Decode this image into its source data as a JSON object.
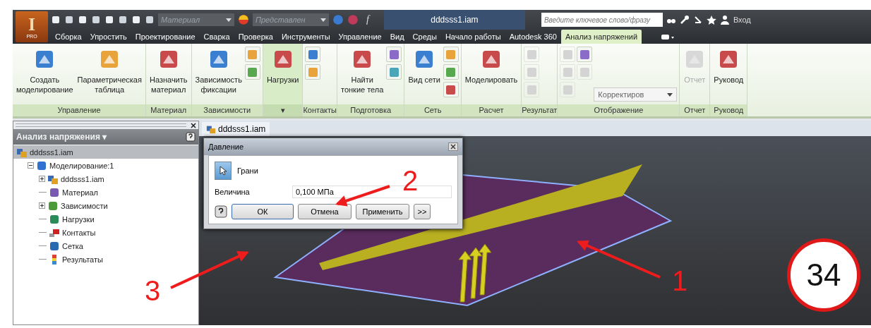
{
  "title_bar": {
    "app_letter": "I",
    "app_edition": "PRO",
    "material_combo": "Материал",
    "appearance_combo": "Представлен",
    "formula_label": "f",
    "document_title": "dddsss1.iam",
    "search": {
      "placeholder": "Введите ключевое слово/фразу"
    },
    "sign_in": "Вход"
  },
  "tabs": [
    {
      "label": "Сборка",
      "selected": false
    },
    {
      "label": "Упростить",
      "selected": false
    },
    {
      "label": "Проектирование",
      "selected": false
    },
    {
      "label": "Сварка",
      "selected": false
    },
    {
      "label": "Проверка",
      "selected": false
    },
    {
      "label": "Инструменты",
      "selected": false
    },
    {
      "label": "Управление",
      "selected": false
    },
    {
      "label": "Вид",
      "selected": false
    },
    {
      "label": "Среды",
      "selected": false
    },
    {
      "label": "Начало работы",
      "selected": false
    },
    {
      "label": "Autodesk 360",
      "selected": false
    },
    {
      "label": "Анализ напряжений",
      "selected": true
    }
  ],
  "ribbon_panels": [
    {
      "label": "Управление",
      "highlighted": false,
      "items": [
        {
          "kind": "large",
          "label": "Создать\nмоделирование",
          "disabled": false
        },
        {
          "kind": "large",
          "label": "Параметрическая\nтаблица",
          "disabled": false
        }
      ]
    },
    {
      "label": "Материал",
      "highlighted": false,
      "items": [
        {
          "kind": "large",
          "label": "Назначить\nматериал",
          "disabled": false
        }
      ]
    },
    {
      "label": "Зависимости",
      "highlighted": false,
      "items": [
        {
          "kind": "large",
          "label": "Зависимость\nфиксации",
          "disabled": false
        },
        {
          "kind": "stack",
          "buttons": [
            {
              "disabled": false
            },
            {
              "disabled": false
            }
          ]
        }
      ]
    },
    {
      "label": "▾",
      "highlighted": true,
      "items": [
        {
          "kind": "large",
          "label": "Нагрузки",
          "disabled": false
        }
      ]
    },
    {
      "label": "Контакты",
      "highlighted": false,
      "items": [
        {
          "kind": "stack",
          "buttons": [
            {
              "disabled": false
            },
            {
              "disabled": false
            }
          ]
        }
      ]
    },
    {
      "label": "Подготовка",
      "highlighted": false,
      "items": [
        {
          "kind": "large",
          "label": "Найти\nтонкие тела",
          "disabled": false
        },
        {
          "kind": "stack",
          "buttons": [
            {
              "disabled": false
            },
            {
              "disabled": false
            }
          ]
        }
      ]
    },
    {
      "label": "Сеть",
      "highlighted": false,
      "items": [
        {
          "kind": "large",
          "label": "Вид сети",
          "disabled": false
        },
        {
          "kind": "stack",
          "buttons": [
            {
              "disabled": false
            },
            {
              "disabled": false
            },
            {
              "disabled": false
            }
          ]
        }
      ]
    },
    {
      "label": "Расчет",
      "highlighted": false,
      "items": [
        {
          "kind": "large",
          "label": "Моделировать",
          "disabled": false
        }
      ]
    },
    {
      "label": "Результат",
      "highlighted": false,
      "items": [
        {
          "kind": "stack",
          "buttons": [
            {
              "disabled": true
            },
            {
              "disabled": true
            },
            {
              "disabled": true
            }
          ]
        }
      ]
    },
    {
      "label": "Отображение",
      "highlighted": false,
      "items": [
        {
          "kind": "stack",
          "buttons": [
            {
              "disabled": true
            },
            {
              "disabled": true
            },
            {
              "disabled": true
            }
          ]
        },
        {
          "kind": "stack",
          "buttons": [
            {
              "disabled": false
            },
            {
              "disabled": true
            }
          ]
        },
        {
          "kind": "combo",
          "value": "Корректиров",
          "disabled": true
        }
      ]
    },
    {
      "label": "Отчет",
      "highlighted": false,
      "items": [
        {
          "kind": "large",
          "label": "Отчет",
          "disabled": true
        }
      ]
    },
    {
      "label": "Руковод",
      "highlighted": false,
      "items": [
        {
          "kind": "large",
          "label": "Руковод",
          "disabled": false
        }
      ]
    }
  ],
  "browser": {
    "title": "Анализ напряжения ▾",
    "tree": [
      {
        "label": "dddsss1.iam",
        "kind": "assembly",
        "selected": true,
        "children": [
          {
            "label": "Моделирование:1",
            "kind": "simulation",
            "selected": false,
            "expanded": true,
            "children": [
              {
                "label": "dddsss1.iam",
                "kind": "assembly",
                "selected": false,
                "expanded": false
              },
              {
                "label": "Материал",
                "kind": "material",
                "selected": false
              },
              {
                "label": "Зависимости",
                "kind": "constraints",
                "selected": false,
                "expanded": false
              },
              {
                "label": "Нагрузки",
                "kind": "loads",
                "selected": false
              },
              {
                "label": "Контакты",
                "kind": "contacts",
                "selected": false
              },
              {
                "label": "Сетка",
                "kind": "mesh",
                "selected": false
              },
              {
                "label": "Результаты",
                "kind": "results",
                "selected": false
              }
            ]
          }
        ]
      }
    ]
  },
  "document_tab": "dddsss1.iam",
  "dialog": {
    "title": "Давление",
    "faces_button": {
      "label": "Грани",
      "selected": true
    },
    "magnitude": {
      "label": "Величина",
      "value": "0,100 МПа"
    },
    "buttons": [
      {
        "label": "ОК",
        "default": true
      },
      {
        "label": "Отмена",
        "default": false
      },
      {
        "label": "Применить",
        "default": false
      },
      {
        "label": ">>",
        "default": false
      }
    ]
  },
  "annotations": [
    {
      "label": "1"
    },
    {
      "label": "2"
    },
    {
      "label": "3"
    },
    {
      "label": "34"
    }
  ]
}
